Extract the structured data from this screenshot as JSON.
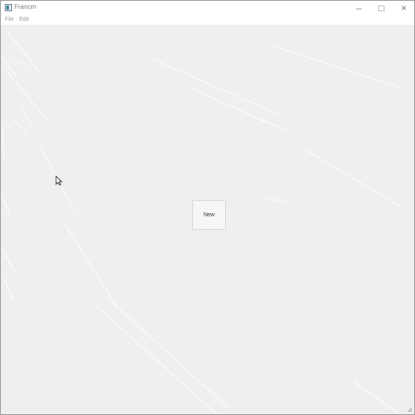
{
  "window": {
    "title": "Francm"
  },
  "window_controls": {
    "minimize": "–",
    "maximize": "□",
    "close": "×"
  },
  "menu": {
    "file": "File",
    "edit": "Edit"
  },
  "main": {
    "new_button_label": "New"
  },
  "icons": {
    "app": "app-icon",
    "minimize": "minimize-icon",
    "maximize": "maximize-icon",
    "close": "close-icon",
    "cursor": "mouse-pointer-icon",
    "resize": "resize-grip-icon"
  }
}
